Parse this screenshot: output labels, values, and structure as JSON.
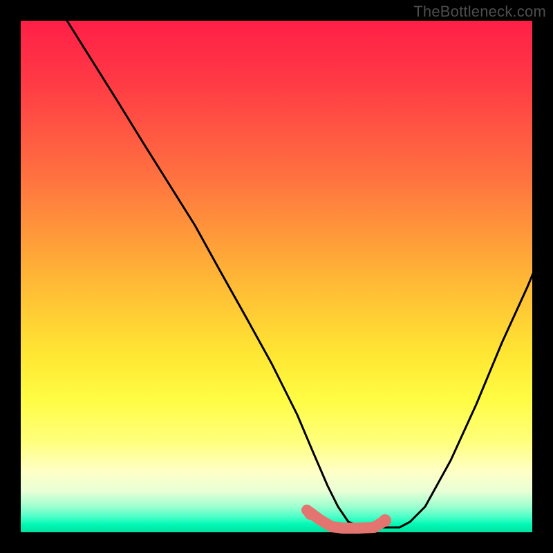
{
  "watermark": "TheBottleneck.com",
  "chart_data": {
    "type": "line",
    "title": "",
    "xlabel": "",
    "ylabel": "",
    "xlim": [
      0,
      100
    ],
    "ylim": [
      0,
      100
    ],
    "grid": false,
    "legend": false,
    "series": [
      {
        "name": "bottleneck-curve",
        "color": "#000000",
        "x": [
          0,
          5,
          10,
          15,
          20,
          25,
          30,
          35,
          40,
          45,
          50,
          53,
          56,
          58,
          60,
          63,
          67,
          70,
          72,
          75,
          80,
          85,
          90,
          95,
          100
        ],
        "values": [
          107,
          100,
          92,
          84,
          76,
          68,
          60,
          51,
          42,
          33,
          23,
          16,
          9,
          5,
          2,
          1,
          1,
          1,
          2,
          5,
          14,
          25,
          37,
          48,
          60
        ]
      },
      {
        "name": "optimal-zone",
        "color": "#e4746f",
        "x": [
          55,
          58,
          60,
          63,
          66,
          69,
          71
        ],
        "values": [
          4,
          2,
          1,
          1,
          1,
          1,
          2
        ]
      }
    ],
    "markers": [
      {
        "name": "left-dot",
        "x": 56,
        "y": 3,
        "color": "#e4746f"
      },
      {
        "name": "right-dot",
        "x": 71,
        "y": 2,
        "color": "#e4746f"
      }
    ],
    "gradient_meaning": "background maps y-value to bottleneck severity: top(red)=high, bottom(green)=none",
    "notes": "Axes present but unlabeled in source image; values are estimated relative coordinates in [0,100]."
  }
}
